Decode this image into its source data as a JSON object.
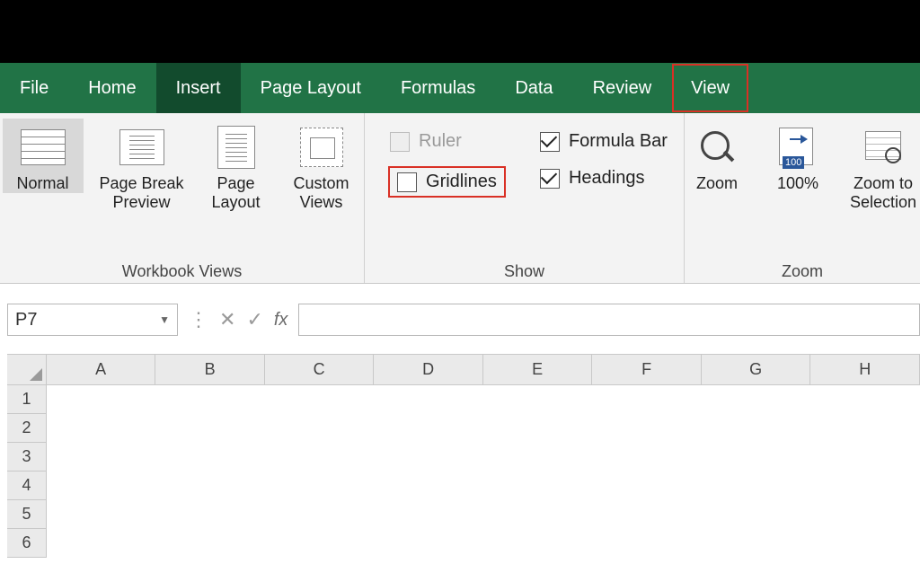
{
  "tabs": {
    "file": "File",
    "home": "Home",
    "insert": "Insert",
    "page_layout": "Page Layout",
    "formulas": "Formulas",
    "data": "Data",
    "review": "Review",
    "view": "View"
  },
  "groups": {
    "workbook_views": {
      "label": "Workbook Views",
      "normal": "Normal",
      "page_break": "Page Break\nPreview",
      "page_layout": "Page\nLayout",
      "custom_views": "Custom\nViews"
    },
    "show": {
      "label": "Show",
      "ruler": "Ruler",
      "gridlines": "Gridlines",
      "formula_bar": "Formula Bar",
      "headings": "Headings",
      "ruler_checked": false,
      "gridlines_checked": false,
      "formula_bar_checked": true,
      "headings_checked": true
    },
    "zoom": {
      "label": "Zoom",
      "zoom": "Zoom",
      "pct100": "100%",
      "zoom_to_selection": "Zoom to\nSelection"
    }
  },
  "name_box": "P7",
  "fx_label": "fx",
  "formula_value": "",
  "columns": [
    "A",
    "B",
    "C",
    "D",
    "E",
    "F",
    "G",
    "H"
  ],
  "rows": [
    "1",
    "2",
    "3",
    "4",
    "5",
    "6"
  ]
}
